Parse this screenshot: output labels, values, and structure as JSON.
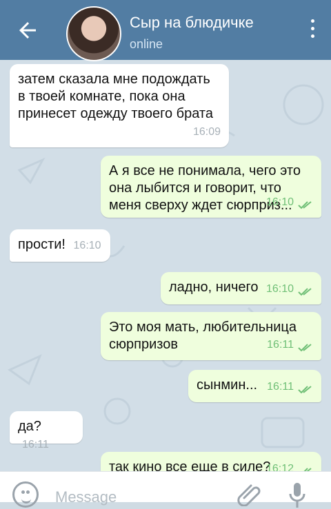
{
  "header": {
    "title": "Сыр на блюдичке",
    "status": "online"
  },
  "messages": [
    {
      "direction": "in",
      "text": "затем сказала мне подождать в твоей комнате, пока она принесет одежду твоего брата",
      "time": "16:09"
    },
    {
      "direction": "out",
      "text": "А я все не понимала, чего это она лыбится и говорит, что меня сверху ждет сюрприз...",
      "time": "16:10"
    },
    {
      "direction": "in",
      "text": "прости!",
      "time": "16:10"
    },
    {
      "direction": "out",
      "text": "ладно, ничего",
      "time": "16:10"
    },
    {
      "direction": "out",
      "text": "Это моя мать, любительница сюрпризов",
      "time": "16:11"
    },
    {
      "direction": "out",
      "text": "сынмин...",
      "time": "16:11"
    },
    {
      "direction": "in",
      "text": "да?",
      "time": "16:11"
    },
    {
      "direction": "out",
      "text": "так кино все еще в силе?",
      "time": "16:12"
    }
  ],
  "input": {
    "placeholder": "Message"
  },
  "icons": {
    "back": "back-arrow-icon",
    "menu": "more-vertical-icon",
    "emoji": "emoji-icon",
    "attach": "paperclip-icon",
    "mic": "microphone-icon",
    "read": "double-check-icon"
  },
  "colors": {
    "header": "#527da3",
    "incoming_bubble": "#ffffff",
    "outgoing_bubble": "#effedd",
    "read_check": "#6fbf76"
  }
}
